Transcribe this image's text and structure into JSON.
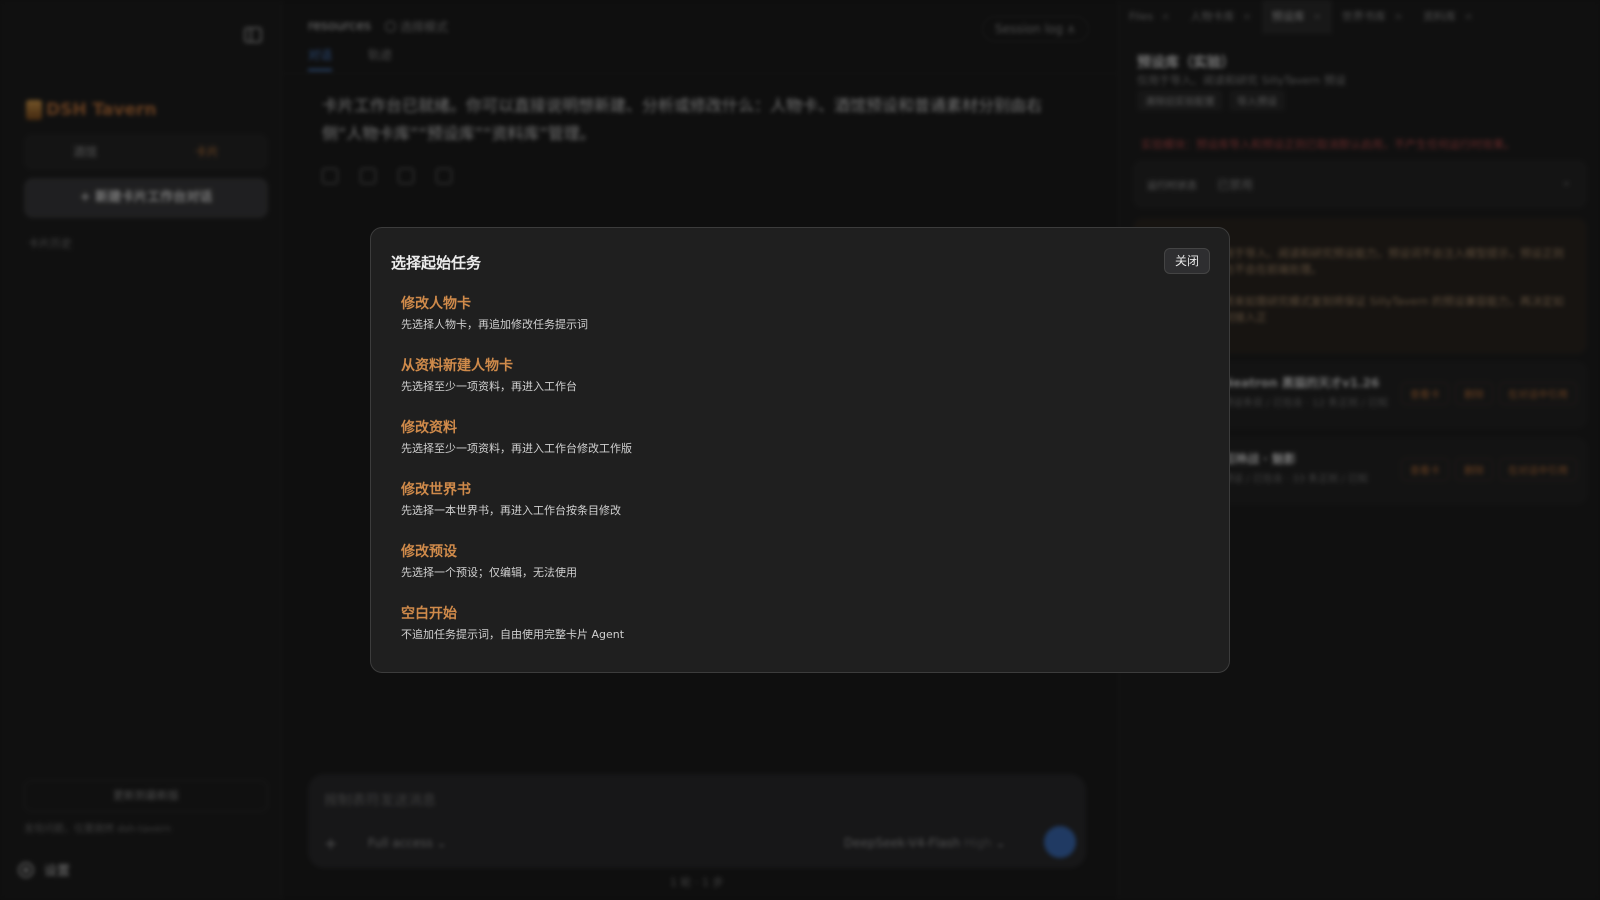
{
  "sidebar": {
    "brand": "DSH Tavern",
    "segments": [
      "酒馆",
      "卡片"
    ],
    "new_button": "+ 新建卡片工作台对话",
    "history_label": "卡片历史",
    "bottom_button": "更新到最新版",
    "note": "发现问题，位置跳转 dsh-tavern",
    "settings_label": "设置"
  },
  "main": {
    "title": "resources",
    "mode": "选择模式",
    "session_log": "Session log ∧",
    "tabs": [
      "对话",
      "轨迹"
    ],
    "message": "卡片工作台已就绪。你可以直接说明想新建、分析或修改什么：人物卡、酒馆预设和普通素材分别由右侧“人物卡库”“预设库”“资料库”管理。",
    "input_placeholder": "按制表符发送消息",
    "access_label": "Full access",
    "model_name": "DeepSeek-V4-Flash",
    "model_level": "High",
    "steps": "1 轮 · 1 步"
  },
  "right": {
    "tabs": [
      {
        "label": "Files",
        "active": false
      },
      {
        "label": "人物卡库",
        "active": false
      },
      {
        "label": "预设库",
        "active": true
      },
      {
        "label": "世界书库",
        "active": false
      },
      {
        "label": "资料库",
        "active": false
      }
    ],
    "title": "预设库（实验）",
    "subtitle": "仅用于导入、阅读和研究 SillyTavern 预设",
    "chips": [
      "清除旧实验配置",
      "导入预设"
    ],
    "warning": "实验模块：预设库导入和预设正则已取消默认启用，不产生任何运行时效果。",
    "select_label": "运行时状态",
    "select_value": "已禁用",
    "notice_lines": [
      "用于导入、阅读和研究预设能力，预设词不会注入模型提示，预设正则也不会在前端处理。",
      "将来如需研究模式复刻将保证 SillyTavern 的预设兼容能力，再决定如何接入正"
    ],
    "cards": [
      {
        "title": "Neatron 黑猫的天才v1.26",
        "meta": "预设条目 / 已包含 · 12 条正则 / 已知",
        "buttons": [
          "查看卡",
          "删除",
          "在对话中引用"
        ]
      },
      {
        "title": "招神战 · 魅影",
        "meta": "预设 / 已包含 · 33 条正则 / 已知",
        "buttons": [
          "查看卡",
          "删除",
          "在对话中引用"
        ]
      }
    ]
  },
  "modal": {
    "title": "选择起始任务",
    "close_label": "关闭",
    "tasks": [
      {
        "title": "修改人物卡",
        "desc": "先选择人物卡，再追加修改任务提示词"
      },
      {
        "title": "从资料新建人物卡",
        "desc": "先选择至少一项资料，再进入工作台"
      },
      {
        "title": "修改资料",
        "desc": "先选择至少一项资料，再进入工作台修改工作版"
      },
      {
        "title": "修改世界书",
        "desc": "先选择一本世界书，再进入工作台按条目修改"
      },
      {
        "title": "修改预设",
        "desc": "先选择一个预设；仅编辑，无法使用"
      },
      {
        "title": "空白开始",
        "desc": "不追加任务提示词，自由使用完整卡片 Agent"
      }
    ]
  }
}
